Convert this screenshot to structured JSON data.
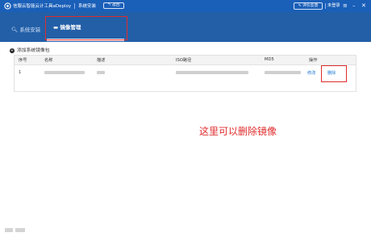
{
  "titlebar": {
    "app_title": "信服云智能云计工具aDeploy",
    "section": "系统安装",
    "back_label": "返回",
    "eval_label": "评价反馈",
    "login_label": "未登录",
    "menu_icon": "≡",
    "minimize_icon": "–",
    "close_icon": "✕"
  },
  "nav": {
    "system_install": "系统安装",
    "image_management": "镜像管理"
  },
  "toolbar": {
    "add_label": "添加系统镜像包"
  },
  "table": {
    "headers": [
      "序号",
      "名称",
      "描述",
      "ISO路径",
      "MD5",
      "操作"
    ],
    "rows": [
      {
        "index": "1",
        "edit": "修改",
        "delete": "删除"
      }
    ]
  },
  "annotation": "这里可以删除镜像"
}
